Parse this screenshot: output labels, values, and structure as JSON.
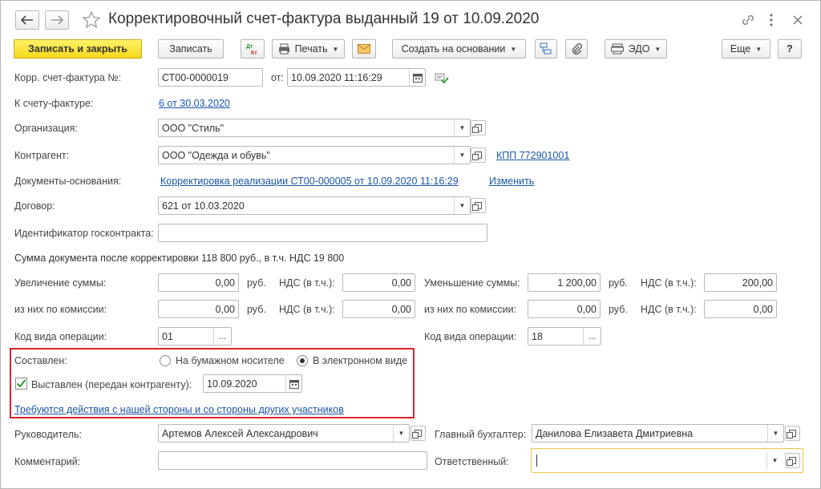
{
  "window": {
    "title": "Корректировочный счет-фактура выданный 19 от 10.09.2020"
  },
  "toolbar": {
    "save_close": "Записать и закрыть",
    "save": "Записать",
    "dt_kt": "Дт Кт",
    "print": "Печать",
    "create_based": "Создать на основании",
    "edo": "ЭДО",
    "more": "Еще",
    "help": "?"
  },
  "form": {
    "corr_invoice_label": "Корр. счет-фактура №:",
    "corr_invoice_number": "СТ00-0000019",
    "from_label": "от:",
    "from_date": "10.09.2020 11:16:29",
    "to_invoice_label": "К счету-фактуре:",
    "to_invoice_link": "6 от 30.03.2020",
    "org_label": "Организация:",
    "org_value": "ООО \"Стиль\"",
    "contractor_label": "Контрагент:",
    "contractor_value": "ООО \"Одежда и обувь\"",
    "kpp_link": "КПП 772901001",
    "docs_label": "Документы-основания:",
    "docs_link": "Корректировка реализации СТ00-000005 от 10.09.2020 11:16:29",
    "docs_change": "Изменить",
    "contract_label": "Договор:",
    "contract_value": "621 от 10.03.2020",
    "gov_contract_label": "Идентификатор госконтракта:",
    "gov_contract_value": "",
    "sum_summary": "Сумма документа после корректировки 118 800 руб., в т.ч. НДС 19 800",
    "increase_label": "Увеличение суммы:",
    "increase_value": "0,00",
    "rub": "руб.",
    "vat_label": "НДС (в т.ч.):",
    "increase_vat": "0,00",
    "decrease_label": "Уменьшение суммы:",
    "decrease_value": "1 200,00",
    "decrease_vat": "200,00",
    "commission_label": "из них по комиссии:",
    "inc_commission_value": "0,00",
    "inc_commission_vat": "0,00",
    "dec_commission_value": "0,00",
    "dec_commission_vat": "0,00",
    "op_code_label": "Код вида операции:",
    "op_code_left": "01",
    "op_code_right": "18",
    "composed_label": "Составлен:",
    "paper_option": "На бумажном носителе",
    "electronic_option": "В электронном виде",
    "issued_label": "Выставлен (передан контрагенту):",
    "issued_date": "10.09.2020",
    "actions_link": "Требуются действия с нашей стороны и со стороны других участников",
    "head_label": "Руководитель:",
    "head_value": "Артемов Алексей Александрович",
    "chief_acc_label": "Главный бухгалтер:",
    "chief_acc_value": "Данилова Елизавета Дмитриевна",
    "comment_label": "Комментарий:",
    "comment_value": "",
    "responsible_label": "Ответственный:",
    "responsible_value": ""
  },
  "colors": {
    "primary_button": "#f7d81a",
    "link": "#1a56a8",
    "highlight_border": "#d9232e",
    "focus_border": "#f0c43c"
  }
}
